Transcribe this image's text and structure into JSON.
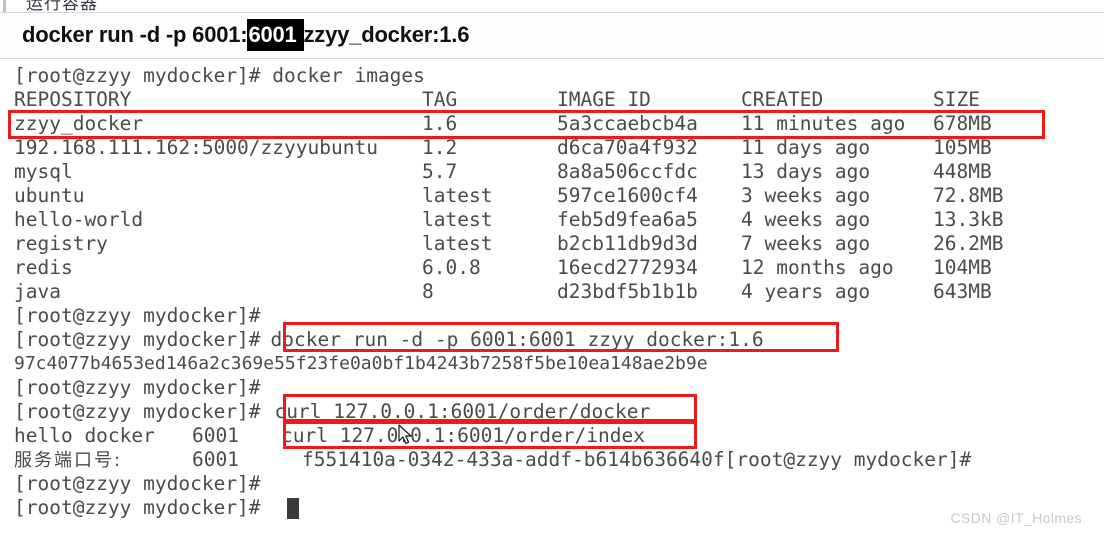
{
  "heading": {
    "text": "运行容器"
  },
  "command_bar": {
    "prefix": "docker run -d -p 6001:",
    "selected": "6001 ",
    "suffix": "zzyy_docker:1.6",
    "full_command": "docker run -d -p 6001:6001 zzyy_docker:1.6",
    "selection_bg": "#000000",
    "selection_fg": "#ffffff"
  },
  "terminal": {
    "prompt": "[root@zzyy mydocker]#",
    "annotation_color": "#ee1b1b",
    "lines": [
      {
        "type": "command",
        "prompt": "[root@zzyy mydocker]#",
        "command": " docker images"
      }
    ],
    "images_table": {
      "headers": [
        "REPOSITORY",
        "TAG",
        "IMAGE ID",
        "CREATED",
        "SIZE"
      ],
      "rows": [
        {
          "repository": "zzyy_docker",
          "tag": "1.6",
          "image_id": "5a3ccaebcb4a",
          "created": "11 minutes ago",
          "size": "678MB",
          "highlighted": true
        },
        {
          "repository": "192.168.111.162:5000/zzyyubuntu",
          "tag": "1.2",
          "image_id": "d6ca70a4f932",
          "created": "11 days ago",
          "size": "105MB",
          "highlighted": false
        },
        {
          "repository": "mysql",
          "tag": "5.7",
          "image_id": "8a8a506ccfdc",
          "created": "13 days ago",
          "size": "448MB",
          "highlighted": false
        },
        {
          "repository": "ubuntu",
          "tag": "latest",
          "image_id": "597ce1600cf4",
          "created": "3 weeks ago",
          "size": "72.8MB",
          "highlighted": false
        },
        {
          "repository": "hello-world",
          "tag": "latest",
          "image_id": "feb5d9fea6a5",
          "created": "4 weeks ago",
          "size": "13.3kB",
          "highlighted": false
        },
        {
          "repository": "registry",
          "tag": "latest",
          "image_id": "b2cb11db9d3d",
          "created": "7 weeks ago",
          "size": "26.2MB",
          "highlighted": false
        },
        {
          "repository": "redis",
          "tag": "6.0.8",
          "image_id": "16ecd2772934",
          "created": "12 months ago",
          "size": "104MB",
          "highlighted": false
        },
        {
          "repository": "java",
          "tag": "8",
          "image_id": "d23bdf5b1b1b",
          "created": "4 years ago",
          "size": "643MB",
          "highlighted": false
        }
      ]
    },
    "empty_prompt_1": "[root@zzyy mydocker]#",
    "run_line": {
      "prompt": "[root@zzyy mydocker]#",
      "command": "docker run -d -p 6001:6001 zzyy_docker:1.6",
      "highlighted": true
    },
    "container_id": "97c4077b4653ed146a2c369e55f23fe0a0bf1b4243b7258f5be10ea148ae2b9e",
    "empty_prompt_2": "[root@zzyy mydocker]#",
    "curl_line_1": {
      "prompt": "[root@zzyy mydocker]#",
      "command": "curl 127.0.0.1:6001/order/docker",
      "highlighted": true
    },
    "curl_output_1": {
      "text": "hello docker",
      "port": "6001"
    },
    "curl_line_2": {
      "command": "curl 127.0.0.1:6001/order/index",
      "highlighted": true
    },
    "curl_output_2": {
      "label": "服务端口号:",
      "port": "6001",
      "uuid": "f551410a-0342-433a-addf-b614b636640f",
      "trailing_prompt": "[root@zzyy mydocker]#"
    },
    "empty_prompt_3": "[root@zzyy mydocker]#",
    "final_prompt": "[root@zzyy mydocker]#",
    "cursor_visible": true
  },
  "watermark": {
    "text": "CSDN @IT_Holmes"
  }
}
